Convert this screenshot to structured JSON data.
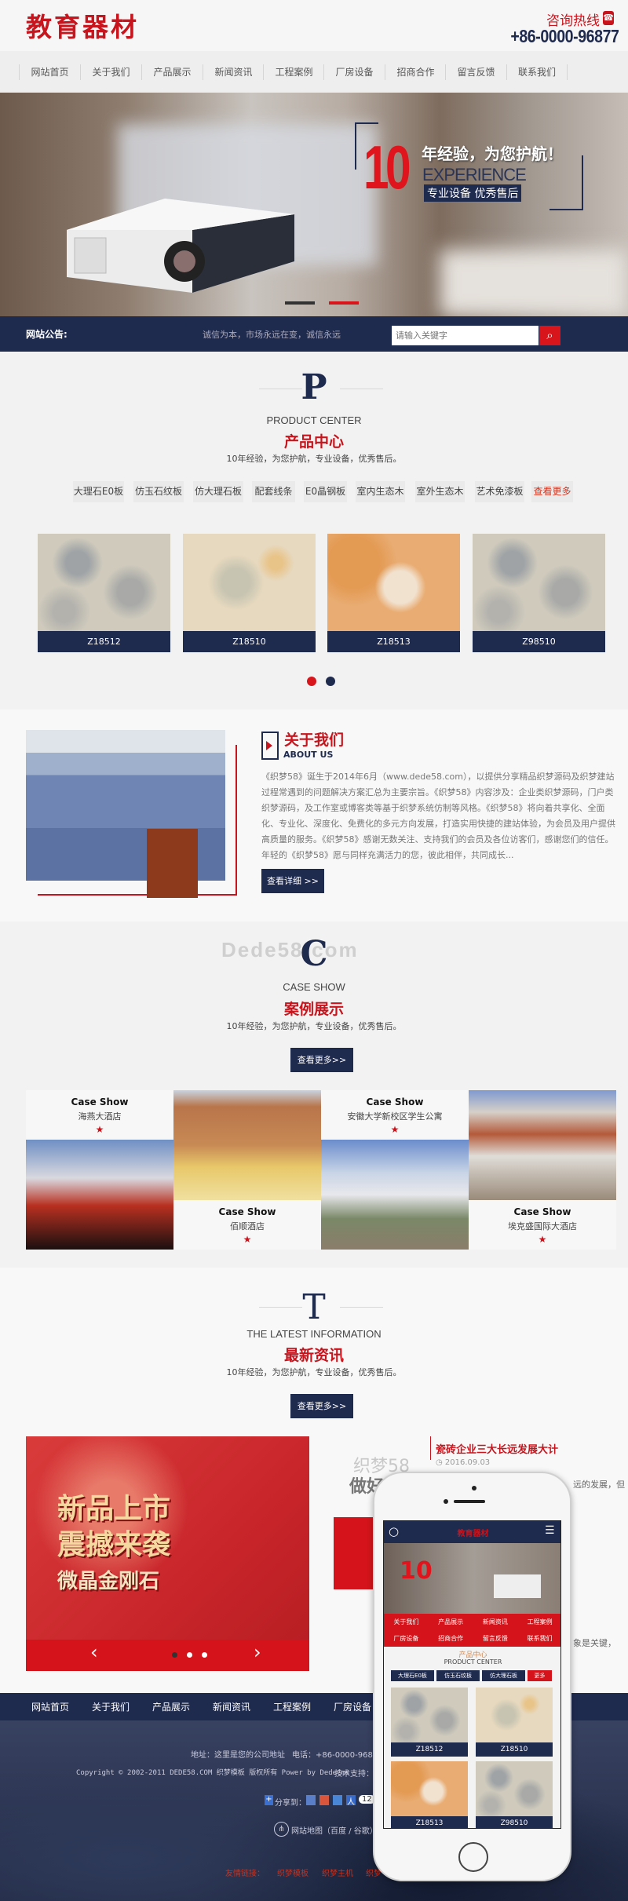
{
  "header": {
    "logo": "教育器材",
    "hotline_label": "咨询热线",
    "hotline": "+86-0000-96877",
    "phone_icon": "phone-icon"
  },
  "nav": [
    "网站首页",
    "关于我们",
    "产品展示",
    "新闻资讯",
    "工程案例",
    "厂房设备",
    "招商合作",
    "留言反馈",
    "联系我们"
  ],
  "banner": {
    "big_number": "10",
    "slogan": "年经验，为您护航！",
    "english": "EXPERIENCE",
    "tagline": "专业设备 优秀售后",
    "active_slide": 2,
    "slide_count": 2
  },
  "notice": {
    "label": "网站公告:",
    "text": "诚信为本，市场永远在变，诚信永远",
    "search_placeholder": "请输入关键字"
  },
  "products": {
    "letter": "P",
    "english": "PRODUCT CENTER",
    "title": "产品中心",
    "subtitle": "10年经验，为您护航，专业设备，优秀售后。",
    "tags": [
      "大理石E0板",
      "仿玉石纹板",
      "仿大理石板",
      "配套线条",
      "E0晶钢板",
      "室内生态木",
      "室外生态木",
      "艺术免漆板"
    ],
    "more": "查看更多",
    "items": [
      {
        "code": "Z18512"
      },
      {
        "code": "Z18510"
      },
      {
        "code": "Z18513"
      },
      {
        "code": "Z98510"
      }
    ],
    "active_page": 1,
    "pages": 2
  },
  "about": {
    "title": "关于我们",
    "english": "ABOUT US",
    "text": "《织梦58》诞生于2014年6月（www.dede58.com），以提供分享精品织梦源码及织梦建站过程常遇到的问题解决方案汇总为主要宗旨。《织梦58》内容涉及：企业类织梦源码，门户类织梦源码，及工作室或博客类等基于织梦系统仿制等风格。《织梦58》将向着共享化、全面化、专业化、深度化、免费化的多元方向发展，打造实用快捷的建站体验，为会员及用户提供高质量的服务。《织梦58》感谢无数关注、支持我们的会员及各位访客们，感谢您们的信任。年轻的《织梦58》愿与同样充满活力的您，彼此相伴，共同成长...",
    "button": "查看详细 >>"
  },
  "cases": {
    "watermark": "Dede58·com",
    "letter": "C",
    "english": "CASE SHOW",
    "title": "案例展示",
    "subtitle": "10年经验，为您护航，专业设备，优秀售后。",
    "button": "查看更多>>",
    "items": [
      {
        "label": "Case Show",
        "name": "海燕大酒店"
      },
      {
        "label": "Case Show",
        "name": "佰顺酒店"
      },
      {
        "label": "Case Show",
        "name": "安徽大学新校区学生公寓"
      },
      {
        "label": "Case Show",
        "name": "埃克盛国际大酒店"
      }
    ]
  },
  "news": {
    "letter": "T",
    "english": "THE LATEST INFORMATION",
    "title": "最新资讯",
    "subtitle": "10年经验，为您护航，专业设备，优秀售后。",
    "button": "查看更多>>",
    "slide_text": [
      "新品上市",
      "震撼来袭",
      "微晶金刚石"
    ],
    "slide_dots": 3,
    "active_dot": 1,
    "thumb_text": [
      "织梦58",
      "做好"
    ],
    "items": [
      {
        "title": "瓷砖企业三大长远发展大计",
        "date": "2016.09.03",
        "excerpt": "远的发展，但"
      },
      {
        "excerpt": "象是关键，"
      }
    ]
  },
  "footer": {
    "nav": [
      "网站首页",
      "关于我们",
      "产品展示",
      "新闻资讯",
      "工程案例",
      "厂房设备"
    ],
    "address": "地址：这里是您的公司地址",
    "phone": "电话：+86-0000-96877",
    "copyright": "Copyright © 2002-2011 DEDE58.COM 织梦模板 版权所有 Power by DedeCms",
    "support": "技术支持：织",
    "share_label": "分享到：",
    "share_count": "12",
    "sitemap": "网站地图（百度 / 谷歌）",
    "links_label": "友情链接：",
    "links": [
      "织梦模板",
      "织梦主机",
      "织梦"
    ]
  },
  "mobile": {
    "logo": "教育器材",
    "nav": [
      "关于我们",
      "产品展示",
      "新闻资讯",
      "工程案例",
      "厂房设备",
      "招商合作",
      "留言反馈",
      "联系我们"
    ],
    "section_title": "产品中心",
    "section_en": "PRODUCT CENTER",
    "tags": [
      "大理石E0板",
      "仿玉石纹板",
      "仿大理石板"
    ],
    "more": "更多",
    "items": [
      "Z18512",
      "Z18510",
      "Z18513",
      "Z98510"
    ]
  },
  "colors": {
    "brand_red": "#c8141c",
    "navy": "#1f2a4f",
    "background": "#f3f2f2"
  }
}
